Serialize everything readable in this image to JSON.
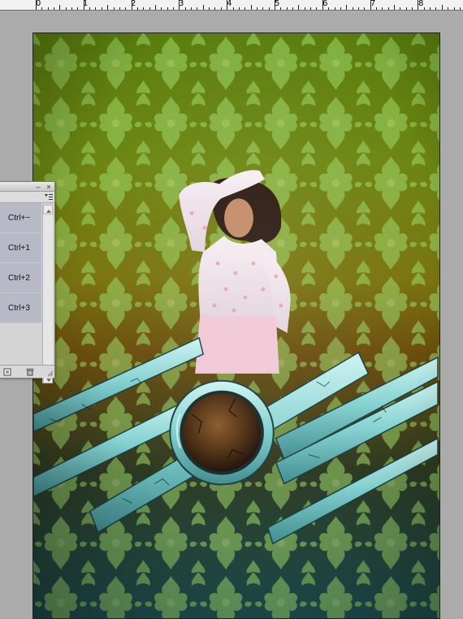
{
  "ruler": {
    "labels": [
      "0",
      "1",
      "2",
      "3",
      "4",
      "5",
      "6",
      "7",
      "8"
    ]
  },
  "panel": {
    "close_glyph": "×",
    "minimize_glyph": "–",
    "rows": [
      {
        "shortcut": "Ctrl+~"
      },
      {
        "shortcut": "Ctrl+1"
      },
      {
        "shortcut": "Ctrl+2"
      },
      {
        "shortcut": "Ctrl+3"
      }
    ],
    "icons": [
      "new-channel-icon",
      "trash-icon",
      "panel-menu-icon",
      "scroll-up-icon",
      "scroll-down-icon"
    ]
  },
  "colors": {
    "background_top": "#5a7d0e",
    "background_mid": "#7a7410",
    "background_bottom": "#1e4e50",
    "damask": "#9fd66a",
    "metal": "#8fdcdc",
    "core": "#4a2e14",
    "panel_row": "#b8b9c6"
  }
}
